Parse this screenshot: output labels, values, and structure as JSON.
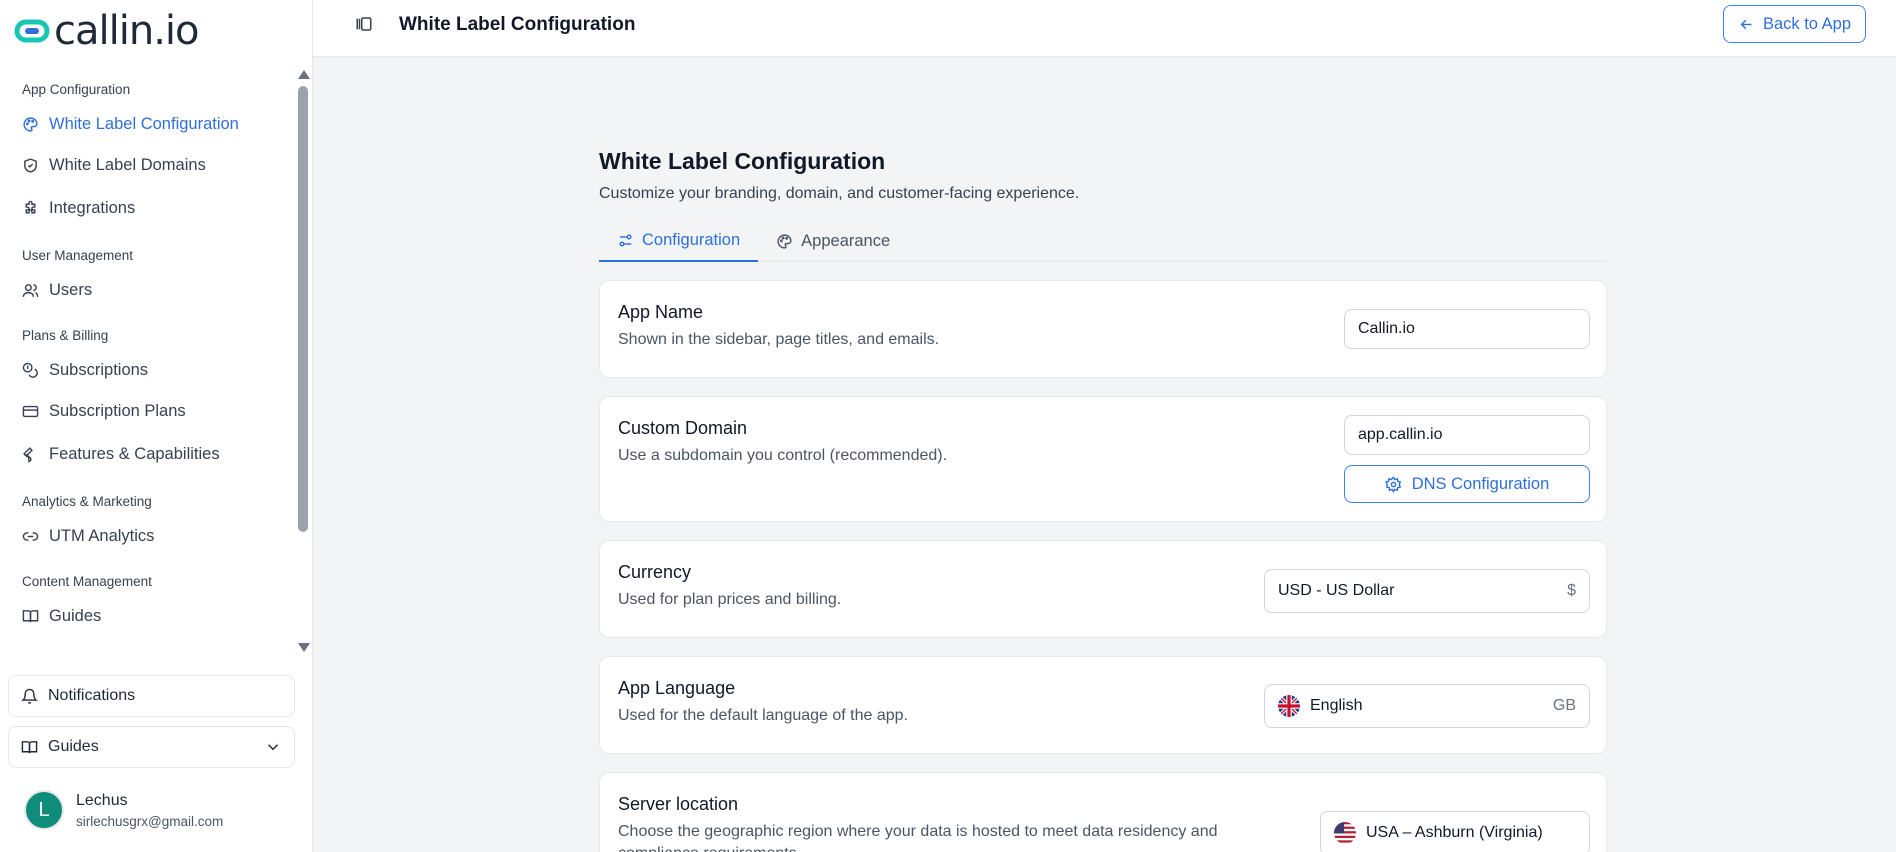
{
  "brand": {
    "name": "callin.io",
    "accent": "#2f6fdc",
    "logo_teal": "#18c6b6"
  },
  "sidebar": {
    "sections": [
      {
        "title": "App Configuration",
        "items": [
          {
            "label": "White Label Configuration",
            "icon": "palette-icon",
            "active": true
          },
          {
            "label": "White Label Domains",
            "icon": "shield-icon"
          },
          {
            "label": "Integrations",
            "icon": "puzzle-icon"
          }
        ]
      },
      {
        "title": "User Management",
        "items": [
          {
            "label": "Users",
            "icon": "users-icon"
          }
        ]
      },
      {
        "title": "Plans & Billing",
        "items": [
          {
            "label": "Subscriptions",
            "icon": "coins-icon"
          },
          {
            "label": "Subscription Plans",
            "icon": "credit-card-icon"
          },
          {
            "label": "Features & Capabilities",
            "icon": "wrench-icon"
          }
        ]
      },
      {
        "title": "Analytics & Marketing",
        "items": [
          {
            "label": "UTM Analytics",
            "icon": "link-icon"
          }
        ]
      },
      {
        "title": "Content Management",
        "items": [
          {
            "label": "Guides",
            "icon": "book-icon"
          }
        ]
      }
    ],
    "notifications_label": "Notifications",
    "guides_label": "Guides",
    "user": {
      "initial": "L",
      "name": "Lechus",
      "email": "sirlechusgrx@gmail.com"
    }
  },
  "header": {
    "title": "White Label Configuration",
    "back_label": "Back to App"
  },
  "main": {
    "title": "White Label Configuration",
    "subtitle": "Customize your branding, domain, and customer-facing experience.",
    "tabs": [
      {
        "label": "Configuration",
        "icon": "sliders-icon",
        "active": true
      },
      {
        "label": "Appearance",
        "icon": "palette-icon"
      }
    ],
    "app_name": {
      "label": "App Name",
      "desc": "Shown in the sidebar, page titles, and emails.",
      "value": "Callin.io"
    },
    "custom_domain": {
      "label": "Custom Domain",
      "desc": "Use a subdomain you control (recommended).",
      "value": "app.callin.io",
      "dns_label": "DNS Configuration"
    },
    "currency": {
      "label": "Currency",
      "desc": "Used for plan prices and billing.",
      "value": "USD - US Dollar",
      "symbol": "$"
    },
    "language": {
      "label": "App Language",
      "desc": "Used for the default language of the app.",
      "value": "English",
      "code": "GB"
    },
    "server": {
      "label": "Server location",
      "desc": "Choose the geographic region where your data is hosted to meet data residency and compliance requirements.",
      "value": "USA – Ashburn (Virginia)"
    }
  }
}
